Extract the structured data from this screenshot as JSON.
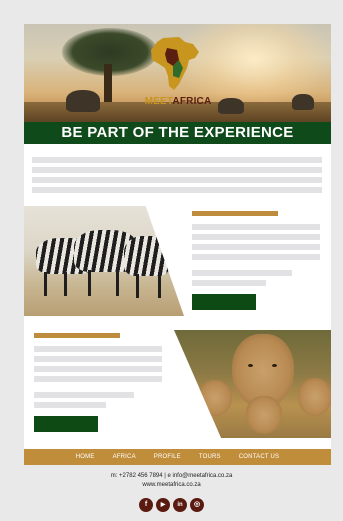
{
  "hero": {
    "logo_meet": "MEET",
    "logo_africa": "AFRICA",
    "headline": "BE PART OF THE EXPERIENCE"
  },
  "nav": {
    "items": [
      "HOME",
      "AFRICA",
      "PROFILE",
      "TOURS",
      "CONTACT US"
    ]
  },
  "footer": {
    "contact_line": "m: +2782 456 7894  |  e info@meetafrica.co.za",
    "website": "www.meetafrica.co.za"
  },
  "socials": [
    {
      "icon": "facebook-icon",
      "glyph": "f"
    },
    {
      "icon": "youtube-icon",
      "glyph": "▶"
    },
    {
      "icon": "linkedin-icon",
      "glyph": "in"
    },
    {
      "icon": "instagram-icon",
      "glyph": "◎"
    }
  ],
  "colors": {
    "banner": "#0f4a1a",
    "accent_gold": "#c08d3b",
    "button_green": "#0d4a14",
    "placeholder_grey": "#e2e2e4",
    "social_bg": "#5a1a10"
  }
}
